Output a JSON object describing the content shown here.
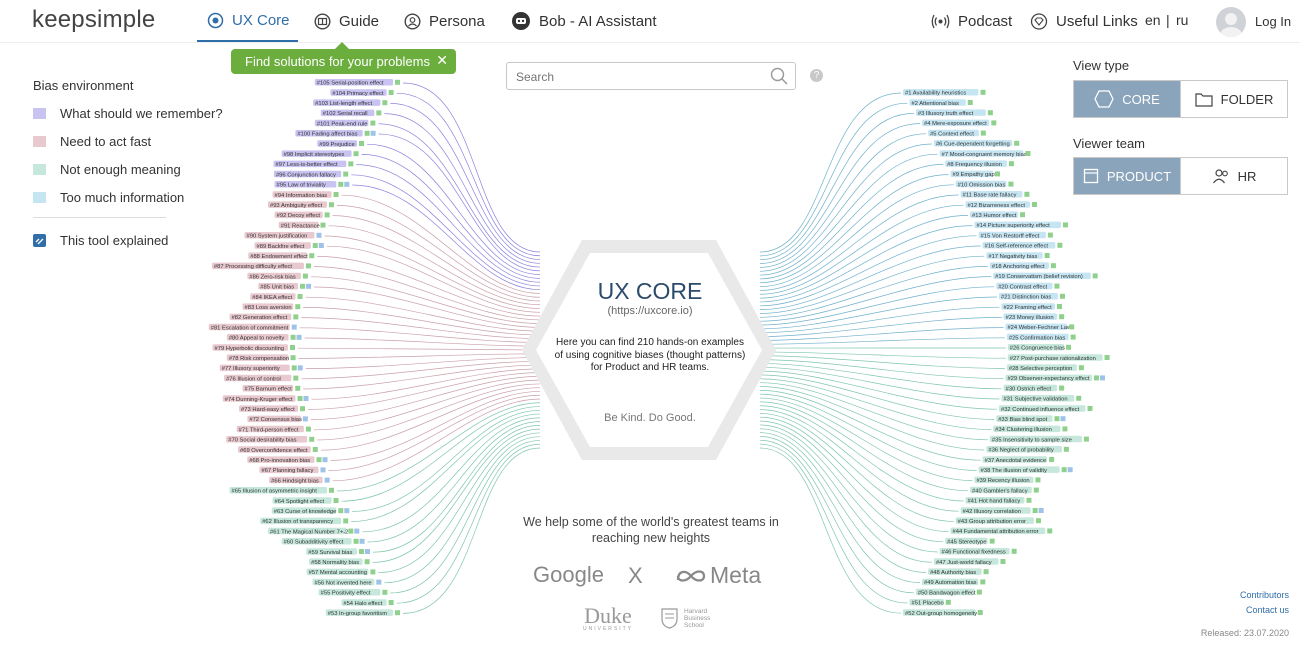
{
  "header": {
    "logo": "keepsimple",
    "nav": [
      {
        "label": "UX Core",
        "icon": "target-icon",
        "active": true
      },
      {
        "label": "Guide",
        "icon": "book-icon",
        "active": false
      },
      {
        "label": "Persona",
        "icon": "person-icon",
        "active": false
      },
      {
        "label": "Bob - AI Assistant",
        "icon": "robot-icon",
        "active": false
      }
    ],
    "podcast_label": "Podcast",
    "useful_links_label": "Useful Links",
    "lang_en": "en",
    "lang_sep": "|",
    "lang_ru": "ru",
    "login_label": "Log In"
  },
  "tooltip": {
    "text": "Find solutions for your problems"
  },
  "legend": {
    "title": "Bias environment",
    "items": [
      {
        "label": "What should we remember?",
        "color": "#c8c3f0"
      },
      {
        "label": "Need to act fast",
        "color": "#e8c9cf"
      },
      {
        "label": "Not enough meaning",
        "color": "#c6e8dc"
      },
      {
        "label": "Too much information",
        "color": "#c6e5f2"
      }
    ],
    "tool_explained": "This tool explained"
  },
  "search": {
    "placeholder": "Search"
  },
  "right_panel": {
    "view_type_title": "View type",
    "view_options": [
      {
        "label": "CORE",
        "active": true
      },
      {
        "label": "FOLDER",
        "active": false
      }
    ],
    "viewer_team_title": "Viewer team",
    "team_options": [
      {
        "label": "PRODUCT",
        "active": true
      },
      {
        "label": "HR",
        "active": false
      }
    ]
  },
  "hex": {
    "title": "UX CORE",
    "url": "(https://uxcore.io)",
    "description": "Here you can find 210 hands-on examples of using cognitive biases (thought patterns) for Product and HR teams.",
    "motto": "Be Kind. Do Good."
  },
  "teams": {
    "text": "We help some of the world's greatest teams in reaching new heights",
    "logos": [
      "Google",
      "X",
      "Meta",
      "Duke",
      "Harvard Business School"
    ],
    "duke_sub": "UNIVERSITY",
    "hbs_line1": "Harvard",
    "hbs_line2": "Business",
    "hbs_line3": "School"
  },
  "footer": {
    "contributors": "Contributors",
    "contact": "Contact us",
    "released": "Released: 23.07.2020"
  },
  "colors": {
    "accent": "#2f6ea8",
    "green": "#6cae3e",
    "memory": "#c8c3f0",
    "act": "#e8c9cf",
    "meaning": "#c6e8dc",
    "info": "#c6e5f2"
  },
  "left_biases": [
    {
      "label": "#105 Serial-position effect",
      "tags": "P"
    },
    {
      "label": "#104 Primacy effect",
      "tags": "P"
    },
    {
      "label": "#103 List-length effect",
      "tags": "P"
    },
    {
      "label": "#102 Serial recall",
      "tags": "P"
    },
    {
      "label": "#101 Peak-end rule",
      "tags": "P"
    },
    {
      "label": "#100 Fading affect bias",
      "tags": "PM"
    },
    {
      "label": "#99 Prejudice",
      "tags": "P"
    },
    {
      "label": "#98 Implicit stereotypes",
      "tags": "P"
    },
    {
      "label": "#97 Less-is-better effect",
      "tags": "P"
    },
    {
      "label": "#96 Conjunction fallacy",
      "tags": "P"
    },
    {
      "label": "#95 Law of triviality",
      "tags": "PM"
    },
    {
      "label": "#94 Information bias",
      "tags": "P"
    },
    {
      "label": "#93 Ambiguity effect",
      "tags": "P"
    },
    {
      "label": "#92 Decoy effect",
      "tags": "P"
    },
    {
      "label": "#91 Reactance",
      "tags": "P"
    },
    {
      "label": "#90 System justification",
      "tags": "M"
    },
    {
      "label": "#89 Backfire effect",
      "tags": "PM"
    },
    {
      "label": "#88 Endowment effect",
      "tags": "P"
    },
    {
      "label": "#87 Processing difficulty effect",
      "tags": "P"
    },
    {
      "label": "#86 Zero-risk bias",
      "tags": "P"
    },
    {
      "label": "#85 Unit bias",
      "tags": "PM"
    },
    {
      "label": "#84 IKEA effect",
      "tags": "P"
    },
    {
      "label": "#83 Loss aversion",
      "tags": "P"
    },
    {
      "label": "#82 Generation effect",
      "tags": "P"
    },
    {
      "label": "#81 Escalation of commitment",
      "tags": "M"
    },
    {
      "label": "#80 Appeal to novelty",
      "tags": "PM"
    },
    {
      "label": "#79 Hyperbolic discounting",
      "tags": "P"
    },
    {
      "label": "#78 Risk compensation",
      "tags": "P"
    },
    {
      "label": "#77 Illusory superiority",
      "tags": "PM"
    },
    {
      "label": "#76 Illusion of control",
      "tags": "P"
    },
    {
      "label": "#75 Barnum effect",
      "tags": "P"
    },
    {
      "label": "#74 Dunning-Kruger effect",
      "tags": "PM"
    },
    {
      "label": "#73 Hard-easy effect",
      "tags": "P"
    },
    {
      "label": "#72 Consensus bias",
      "tags": "M"
    },
    {
      "label": "#71 Third-person effect",
      "tags": "P"
    },
    {
      "label": "#70 Social desirability bias",
      "tags": "P"
    },
    {
      "label": "#69 Overconfidence effect",
      "tags": "P"
    },
    {
      "label": "#68 Pro-innovation bias",
      "tags": "PM"
    },
    {
      "label": "#67 Planning fallacy",
      "tags": "M"
    },
    {
      "label": "#66 Hindsight bias",
      "tags": "M"
    },
    {
      "label": "#65 Illusion of asymmetric insight",
      "tags": "P"
    },
    {
      "label": "#64 Spotlight effect",
      "tags": "P"
    },
    {
      "label": "#63 Curse of knowledge",
      "tags": "PM"
    },
    {
      "label": "#62 Illusion of transparency",
      "tags": "P"
    },
    {
      "label": "#61 The Magical Number 7+-2",
      "tags": "PM"
    },
    {
      "label": "#60 Subadditivity effect",
      "tags": "PM"
    },
    {
      "label": "#59 Survival bias",
      "tags": "PM"
    },
    {
      "label": "#58 Normality bias",
      "tags": "P"
    },
    {
      "label": "#57 Mental accounting",
      "tags": "P"
    },
    {
      "label": "#56 Not invented here",
      "tags": "M"
    },
    {
      "label": "#55 Positivity effect",
      "tags": "P"
    },
    {
      "label": "#54 Halo effect",
      "tags": "P"
    },
    {
      "label": "#53 In-group favoritism",
      "tags": "P"
    }
  ],
  "right_biases": [
    {
      "label": "#1 Availability heuristics",
      "tags": "P"
    },
    {
      "label": "#2 Attentional bias",
      "tags": "P"
    },
    {
      "label": "#3 Illusory truth effect",
      "tags": "P"
    },
    {
      "label": "#4 Mere-exposure effect",
      "tags": "P"
    },
    {
      "label": "#5 Context effect",
      "tags": "P"
    },
    {
      "label": "#6 Cue-dependent forgetting",
      "tags": "P"
    },
    {
      "label": "#7 Mood-congruent memory bias",
      "tags": "P"
    },
    {
      "label": "#8 Frequency illusion",
      "tags": "P"
    },
    {
      "label": "#9 Empathy gap",
      "tags": "P"
    },
    {
      "label": "#10 Omission bias",
      "tags": "P"
    },
    {
      "label": "#11 Base rate fallacy",
      "tags": "P"
    },
    {
      "label": "#12 Bizarreness effect",
      "tags": "P"
    },
    {
      "label": "#13 Humor effect",
      "tags": "P"
    },
    {
      "label": "#14 Picture superiority effect",
      "tags": "P"
    },
    {
      "label": "#15 Von Restorff effect",
      "tags": "P"
    },
    {
      "label": "#16 Self-reference effect",
      "tags": "P"
    },
    {
      "label": "#17 Negativity bias",
      "tags": "P"
    },
    {
      "label": "#18 Anchoring effect",
      "tags": "P"
    },
    {
      "label": "#19 Conservatism (belief revision)",
      "tags": "P"
    },
    {
      "label": "#20 Contrast effect",
      "tags": "P"
    },
    {
      "label": "#21 Distinction bias",
      "tags": "P"
    },
    {
      "label": "#22 Framing effect",
      "tags": "P"
    },
    {
      "label": "#23 Money illusion",
      "tags": "P"
    },
    {
      "label": "#24 Weber-Fechner Law",
      "tags": "P"
    },
    {
      "label": "#25 Confirmation bias",
      "tags": "P"
    },
    {
      "label": "#26 Congruence bias",
      "tags": "P"
    },
    {
      "label": "#27 Post-purchase rationalization",
      "tags": "P"
    },
    {
      "label": "#28 Selective perception",
      "tags": "P"
    },
    {
      "label": "#29 Observer-expectancy effect",
      "tags": "PM"
    },
    {
      "label": "#30 Ostrich effect",
      "tags": "P"
    },
    {
      "label": "#31 Subjective validation",
      "tags": "P"
    },
    {
      "label": "#32 Continued influence effect",
      "tags": "P"
    },
    {
      "label": "#33 Bias blind spot",
      "tags": "PM"
    },
    {
      "label": "#34 Clustering illusion",
      "tags": "P"
    },
    {
      "label": "#35 Insensitivity to sample size",
      "tags": "P"
    },
    {
      "label": "#36 Neglect of probability",
      "tags": "P"
    },
    {
      "label": "#37 Anecdotal evidence",
      "tags": "P"
    },
    {
      "label": "#38 The illusion of validity",
      "tags": "PM"
    },
    {
      "label": "#39 Recency illusion",
      "tags": "P"
    },
    {
      "label": "#40 Gambler's fallacy",
      "tags": "P"
    },
    {
      "label": "#41 Hot hand fallacy",
      "tags": "P"
    },
    {
      "label": "#42 Illusory correlation",
      "tags": "PM"
    },
    {
      "label": "#43 Group attribution error",
      "tags": "P"
    },
    {
      "label": "#44 Fundamental attribution error",
      "tags": "P"
    },
    {
      "label": "#45 Stereotype",
      "tags": "P"
    },
    {
      "label": "#46 Functional fixedness",
      "tags": "P"
    },
    {
      "label": "#47 Just-world fallacy",
      "tags": "P"
    },
    {
      "label": "#48 Authority bias",
      "tags": "P"
    },
    {
      "label": "#49 Automation bias",
      "tags": "P"
    },
    {
      "label": "#50 Bandwagon effect",
      "tags": "P"
    },
    {
      "label": "#51 Placebo",
      "tags": "P"
    },
    {
      "label": "#52 Out-group homogeneity",
      "tags": "P"
    }
  ]
}
